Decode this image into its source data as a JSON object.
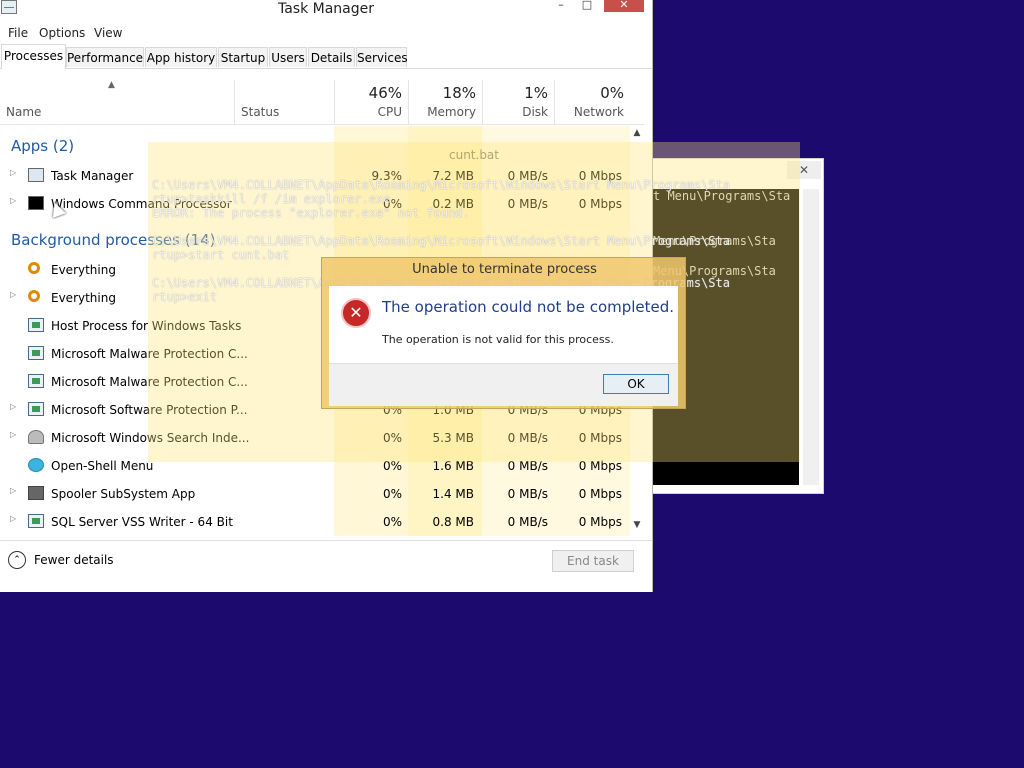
{
  "window": {
    "title": "Task Manager",
    "minimize": "–",
    "maximize": "□",
    "close": "✕"
  },
  "menu": [
    "File",
    "Options",
    "View"
  ],
  "tabs": [
    "Processes",
    "Performance",
    "App history",
    "Startup",
    "Users",
    "Details",
    "Services"
  ],
  "header": {
    "name": "Name",
    "status": "Status",
    "cpu_pct": "46%",
    "cpu": "CPU",
    "mem_pct": "18%",
    "mem": "Memory",
    "disk_pct": "1%",
    "disk": "Disk",
    "net_pct": "0%",
    "net": "Network",
    "sort_arrow": "▲"
  },
  "groups": {
    "apps": "Apps (2)",
    "background": "Background processes (14)"
  },
  "rows": [
    {
      "name": "Task Manager",
      "cpu": "9.3%",
      "mem": "7.2 MB",
      "disk": "0 MB/s",
      "net": "0 Mbps",
      "icon": "task-manager-icon"
    },
    {
      "name": "Windows Command Processor",
      "cpu": "0%",
      "mem": "0.2 MB",
      "disk": "0 MB/s",
      "net": "0 Mbps",
      "icon": "cmd-icon"
    },
    {
      "name": "Everything",
      "cpu": "",
      "mem": "",
      "disk": "",
      "net": "",
      "icon": "search-icon"
    },
    {
      "name": "Everything",
      "cpu": "",
      "mem": "",
      "disk": "",
      "net": "",
      "icon": "search-icon"
    },
    {
      "name": "Host Process for Windows Tasks",
      "cpu": "",
      "mem": "",
      "disk": "",
      "net": "",
      "icon": "service-icon"
    },
    {
      "name": "Microsoft Malware Protection C...",
      "cpu": "",
      "mem": "",
      "disk": "",
      "net": "",
      "icon": "service-icon"
    },
    {
      "name": "Microsoft Malware Protection C...",
      "cpu": "",
      "mem": "",
      "disk": "",
      "net": "",
      "icon": "service-icon"
    },
    {
      "name": "Microsoft Software Protection P...",
      "cpu": "0%",
      "mem": "1.0 MB",
      "disk": "0 MB/s",
      "net": "0 Mbps",
      "icon": "service-icon"
    },
    {
      "name": "Microsoft Windows Search Inde...",
      "cpu": "0%",
      "mem": "5.3 MB",
      "disk": "0 MB/s",
      "net": "0 Mbps",
      "icon": "user-icon"
    },
    {
      "name": "Open-Shell Menu",
      "cpu": "0%",
      "mem": "1.6 MB",
      "disk": "0 MB/s",
      "net": "0 Mbps",
      "icon": "globe-icon"
    },
    {
      "name": "Spooler SubSystem App",
      "cpu": "0%",
      "mem": "1.4 MB",
      "disk": "0 MB/s",
      "net": "0 Mbps",
      "icon": "printer-icon"
    },
    {
      "name": "SQL Server VSS Writer - 64 Bit",
      "cpu": "0%",
      "mem": "0.8 MB",
      "disk": "0 MB/s",
      "net": "0 Mbps",
      "icon": "service-icon"
    }
  ],
  "footer": {
    "fewer": "Fewer details",
    "fewer_icon": "⌃",
    "end_task": "End task"
  },
  "cmd": {
    "title": "cunt.bat",
    "lines": "C:\\Users\\VM4.COLLABNET\\AppData\\Roaming\\Microsoft\\Windows\\Start Menu\\Programs\\Sta\nrtup>taskkill /f /im explorer.exe\nERROR: The process \"explorer.exe\" not found.\n\nC:\\Users\\VM4.COLLABNET\\AppData\\Roaming\\Microsoft\\Windows\\Start Menu\\Programs\\Sta\nrtup>start cunt.bat\n\nC:\\Users\\VM4.COLLABNET\\AppData\\Roaming\\Microsoft\\Windows\\Start Menu\\Programs\\Sta\nrtup>exit",
    "right_lines": "t Menu\\Programs\\Sta\n\n\nMenu\\Programs\\Sta\n\nMenu\\Programs\\Sta"
  },
  "dialog": {
    "title": "Unable to terminate process",
    "icon": "✕",
    "main": "The operation could not be completed.",
    "sub": "The operation is not valid for this process.",
    "ok": "OK"
  },
  "colors": {
    "desktop": "#1c0a6e",
    "group_title": "#1f5aa8",
    "heat_yellow": "#fff4c4",
    "dialog_main": "#1f3e8a"
  }
}
